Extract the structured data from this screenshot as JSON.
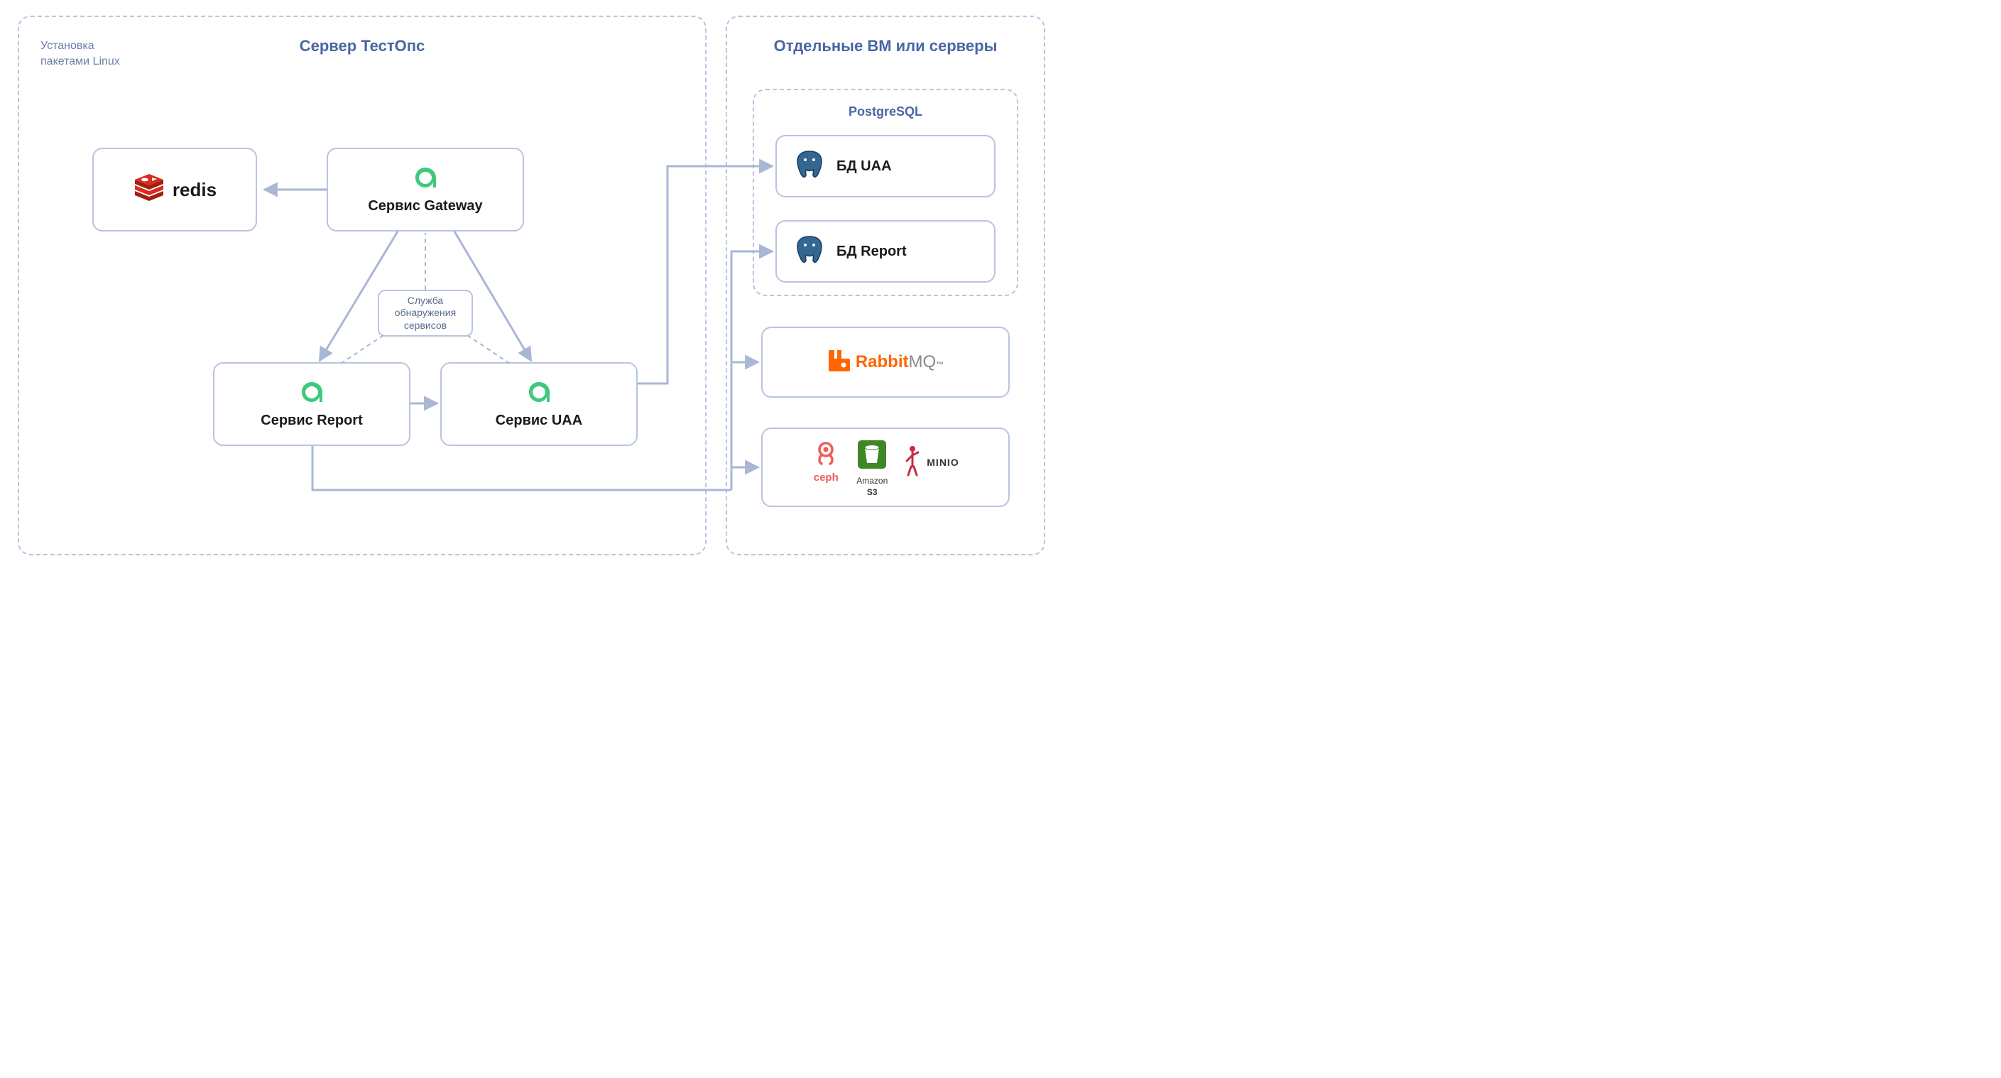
{
  "leftGroup": {
    "subtitle_line1": "Установка",
    "subtitle_line2": "пакетами Linux",
    "title": "Сервер ТестОпс"
  },
  "rightGroup": {
    "title": "Отдельные ВМ или серверы"
  },
  "nodes": {
    "redis": "redis",
    "gateway": "Сервис Gateway",
    "report": "Сервис Report",
    "uaa": "Сервис UAA",
    "discovery_line1": "Служба",
    "discovery_line2": "обнаружения",
    "discovery_line3": "сервисов"
  },
  "postgres": {
    "group": "PostgreSQL",
    "db_uaa": "БД UAA",
    "db_report": "БД Report"
  },
  "rabbit": {
    "label_a": "Rabbit",
    "label_b": "MQ"
  },
  "storage": {
    "ceph": "ceph",
    "s3_line1": "Amazon",
    "s3_line2": "S3",
    "minio": "MINIO"
  },
  "colors": {
    "stroke": "#b8c4e0",
    "arrow": "#a9b6d6",
    "titleText": "#4a66a3",
    "redis1": "#a41e11",
    "redis2": "#d82c20",
    "allure": "#3ec97b",
    "pg": "#336791",
    "rabbit": "#f60",
    "ceph": "#ef5c55",
    "s3": "#3f8624",
    "minio": "#c72c48"
  }
}
